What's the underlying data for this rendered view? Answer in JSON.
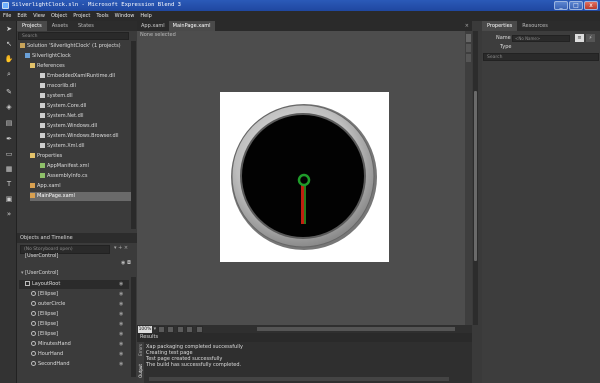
{
  "window": {
    "title": "SilverlightClock.sln - Microsoft Expression Blend 3",
    "min": "_",
    "max": "□",
    "close": "x"
  },
  "menu": [
    "File",
    "Edit",
    "View",
    "Object",
    "Project",
    "Tools",
    "Window",
    "Help"
  ],
  "project_panel": {
    "tabs": [
      "Projects",
      "Assets",
      "States"
    ],
    "search_placeholder": "Search",
    "tree": [
      {
        "label": "Solution 'SilverlightClock' (1 projects)",
        "indent": 0
      },
      {
        "label": "SilverlightClock",
        "indent": 1
      },
      {
        "label": "References",
        "indent": 2
      },
      {
        "label": "EmbeddedXamlRuntime.dll",
        "indent": 4
      },
      {
        "label": "mscorlib.dll",
        "indent": 4
      },
      {
        "label": "system.dll",
        "indent": 4
      },
      {
        "label": "System.Core.dll",
        "indent": 4
      },
      {
        "label": "System.Net.dll",
        "indent": 4
      },
      {
        "label": "System.Windows.dll",
        "indent": 4
      },
      {
        "label": "System.Windows.Browser.dll",
        "indent": 4
      },
      {
        "label": "System.Xml.dll",
        "indent": 4
      },
      {
        "label": "Properties",
        "indent": 2
      },
      {
        "label": "AppManifest.xml",
        "indent": 4
      },
      {
        "label": "AssemblyInfo.cs",
        "indent": 4
      },
      {
        "label": "App.xaml",
        "indent": 2
      },
      {
        "label": "MainPage.xaml",
        "indent": 2
      }
    ]
  },
  "objects_panel": {
    "title": "Objects and Timeline",
    "storyboard": "(No Storyboard open)",
    "root": "[UserControl]",
    "user_control": "[UserControl]",
    "tree": [
      {
        "label": "LayoutRoot",
        "indent": 1
      },
      {
        "label": "[Ellipse]",
        "indent": 2
      },
      {
        "label": "outerCircle",
        "indent": 2
      },
      {
        "label": "[Ellipse]",
        "indent": 2
      },
      {
        "label": "[Ellipse]",
        "indent": 2
      },
      {
        "label": "[Ellipse]",
        "indent": 2
      },
      {
        "label": "MinutesHand",
        "indent": 2
      },
      {
        "label": "HourHand",
        "indent": 2
      },
      {
        "label": "SecondHand",
        "indent": 2
      }
    ]
  },
  "documents": {
    "tabs": [
      "App.xaml",
      "MainPage.xaml"
    ],
    "breadcrumb": "None selected",
    "zoom": "100%"
  },
  "results": {
    "title": "Results",
    "side_tabs": [
      "Errors",
      "Output"
    ],
    "lines": [
      "Xap packaging completed successfully",
      "Creating test page",
      "Test page created successfully",
      "The build has successfully completed."
    ]
  },
  "properties_panel": {
    "tabs": [
      "Properties",
      "Resources"
    ],
    "name_label": "Name",
    "type_label": "Type",
    "name_value": "<No Name>",
    "type_value": "",
    "search_placeholder": "Search"
  }
}
